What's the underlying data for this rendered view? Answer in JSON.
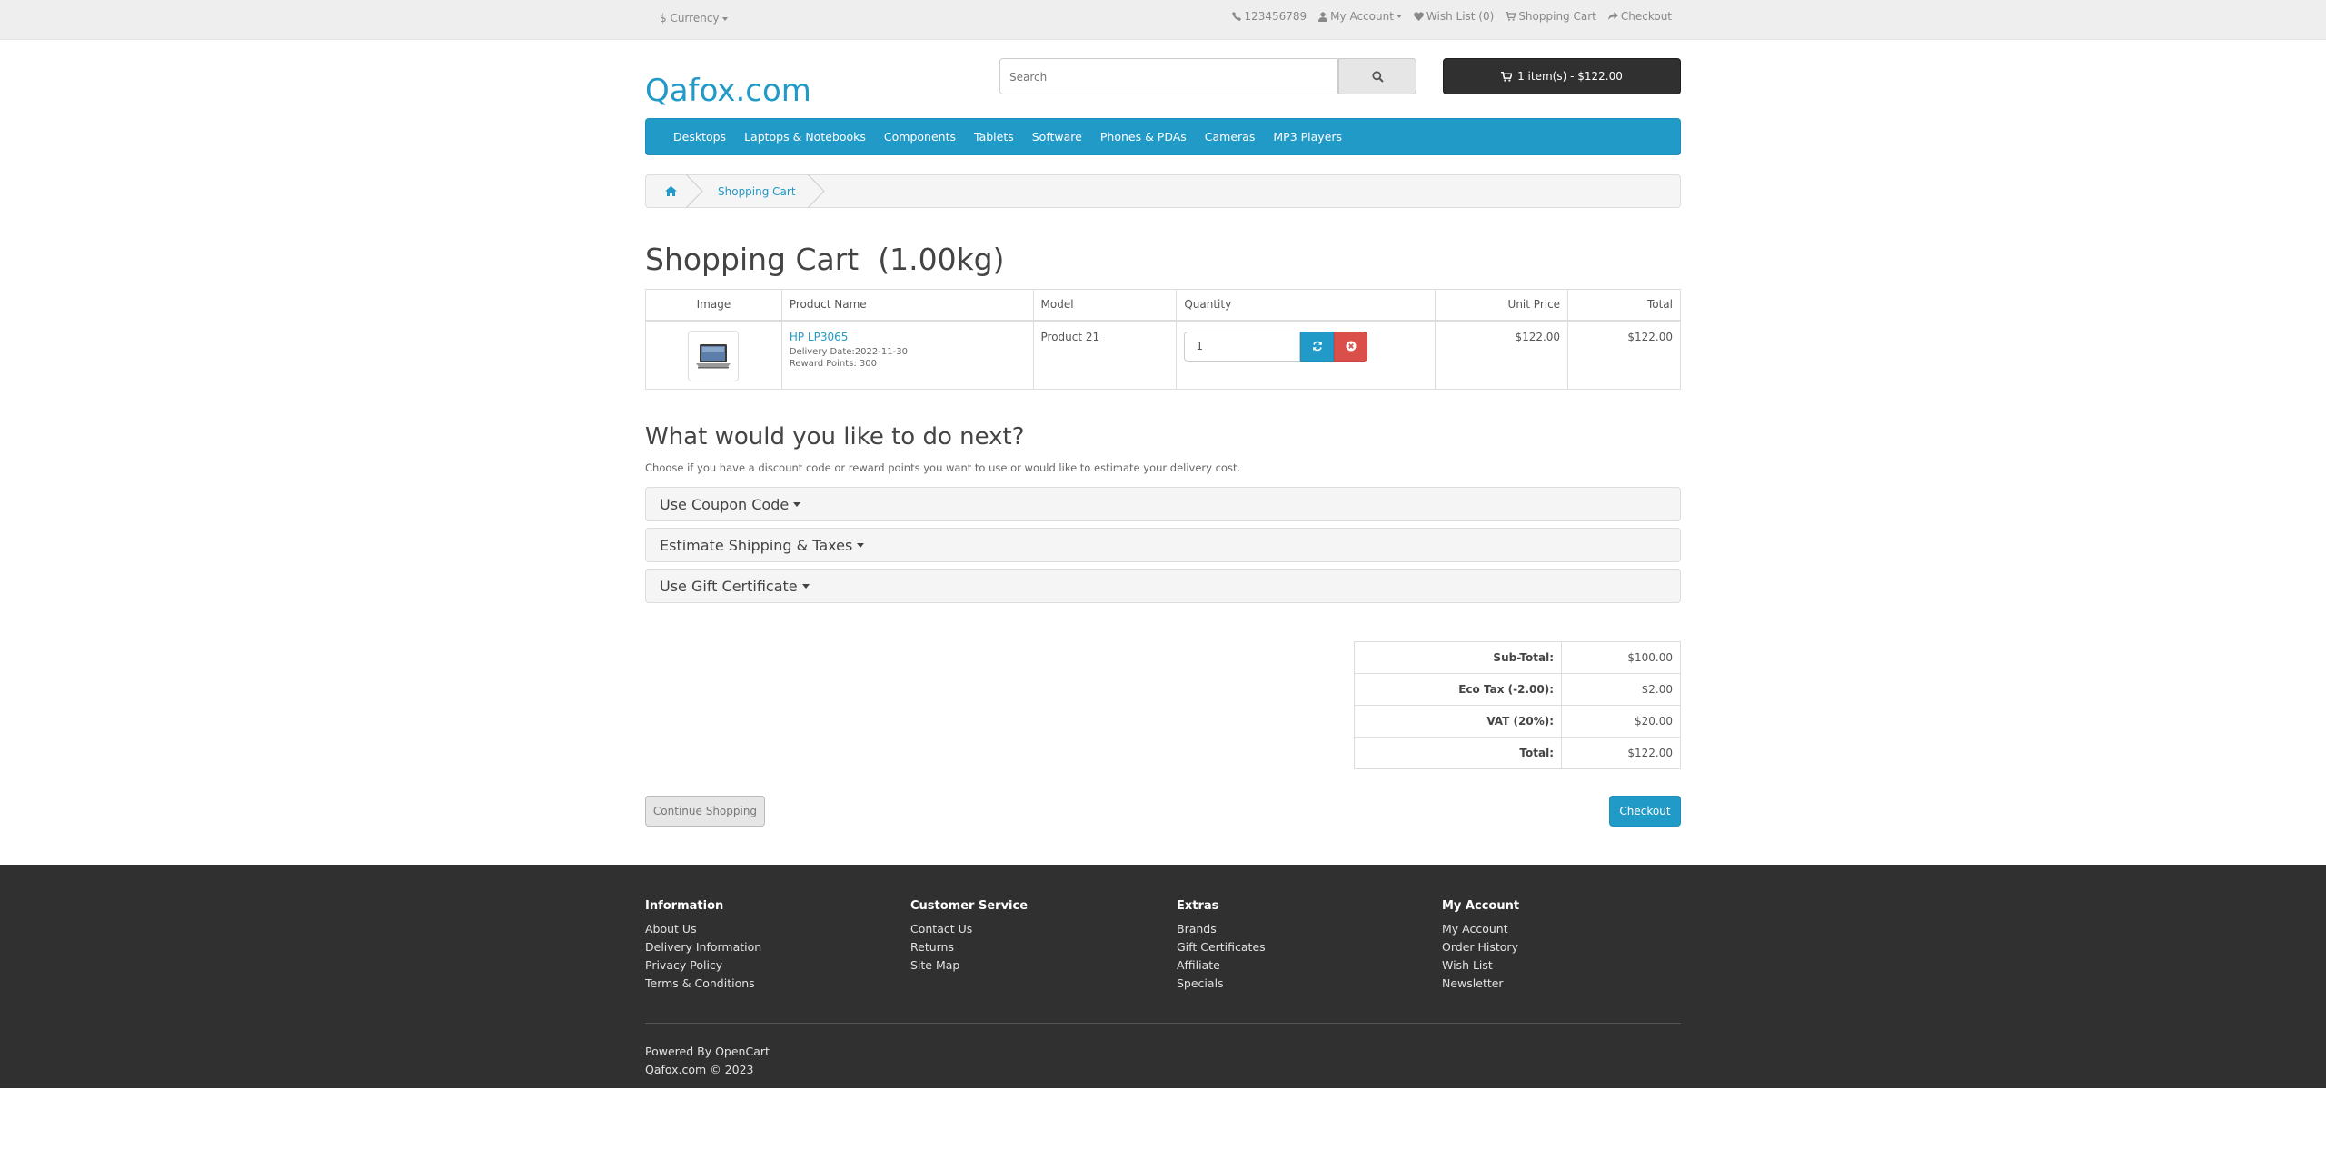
{
  "topbar": {
    "currency_label": "$ Currency",
    "phone": "123456789",
    "my_account": "My Account",
    "wish_list": "Wish List (0)",
    "shopping_cart": "Shopping Cart",
    "checkout": "Checkout"
  },
  "header": {
    "logo": "Qafox.com",
    "search_placeholder": "Search",
    "cart_button": "1 item(s) - $122.00"
  },
  "menu": {
    "items": [
      "Desktops",
      "Laptops & Notebooks",
      "Components",
      "Tablets",
      "Software",
      "Phones & PDAs",
      "Cameras",
      "MP3 Players"
    ]
  },
  "breadcrumb": {
    "current": "Shopping Cart"
  },
  "page": {
    "title": "Shopping Cart  (1.00kg)"
  },
  "cart_table": {
    "headers": {
      "image": "Image",
      "product_name": "Product Name",
      "model": "Model",
      "quantity": "Quantity",
      "unit_price": "Unit Price",
      "total": "Total"
    },
    "rows": [
      {
        "product_name": "HP LP3065",
        "delivery_date": "Delivery Date:2022-11-30",
        "reward_points": "Reward Points: 300",
        "model": "Product 21",
        "quantity": "1",
        "unit_price": "$122.00",
        "total": "$122.00"
      }
    ]
  },
  "next": {
    "title": "What would you like to do next?",
    "description": "Choose if you have a discount code or reward points you want to use or would like to estimate your delivery cost.",
    "panels": [
      "Use Coupon Code",
      "Estimate Shipping & Taxes",
      "Use Gift Certificate"
    ]
  },
  "totals": [
    {
      "label": "Sub-Total:",
      "value": "$100.00"
    },
    {
      "label": "Eco Tax (-2.00):",
      "value": "$2.00"
    },
    {
      "label": "VAT (20%):",
      "value": "$20.00"
    },
    {
      "label": "Total:",
      "value": "$122.00"
    }
  ],
  "buttons": {
    "continue_shopping": "Continue Shopping",
    "checkout": "Checkout"
  },
  "footer": {
    "columns": [
      {
        "title": "Information",
        "links": [
          "About Us",
          "Delivery Information",
          "Privacy Policy",
          "Terms & Conditions"
        ]
      },
      {
        "title": "Customer Service",
        "links": [
          "Contact Us",
          "Returns",
          "Site Map"
        ]
      },
      {
        "title": "Extras",
        "links": [
          "Brands",
          "Gift Certificates",
          "Affiliate",
          "Specials"
        ]
      },
      {
        "title": "My Account",
        "links": [
          "My Account",
          "Order History",
          "Wish List",
          "Newsletter"
        ]
      }
    ],
    "powered_prefix": "Powered By",
    "powered_link": "OpenCart",
    "copyright": "Qafox.com © 2023"
  },
  "colors": {
    "accent": "#229ac8",
    "dark": "#303030",
    "danger": "#da4f49"
  }
}
